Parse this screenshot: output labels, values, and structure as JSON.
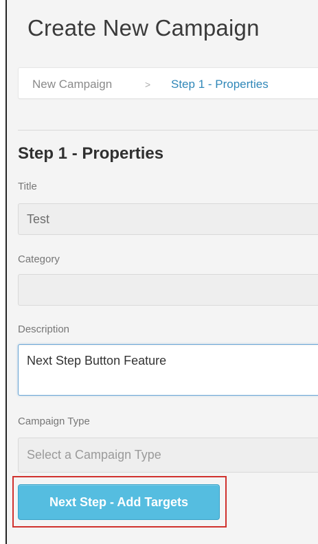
{
  "header": {
    "title": "Create New Campaign"
  },
  "breadcrumb": {
    "items": [
      {
        "label": "New Campaign"
      },
      {
        "label": "Step 1 - Properties"
      }
    ],
    "separator": ">"
  },
  "form": {
    "section_title": "Step 1 - Properties",
    "title_field": {
      "label": "Title",
      "value": "Test"
    },
    "category_field": {
      "label": "Category",
      "value": ""
    },
    "description_field": {
      "label": "Description",
      "value": "Next Step Button Feature"
    },
    "campaign_type_field": {
      "label": "Campaign Type",
      "placeholder": "Select a Campaign Type"
    },
    "next_button": {
      "label": "Next Step - Add Targets"
    }
  },
  "colors": {
    "accent": "#55bde0",
    "link": "#2f87b8",
    "highlight": "#d0312d",
    "focus_border": "#6aa6d6"
  }
}
